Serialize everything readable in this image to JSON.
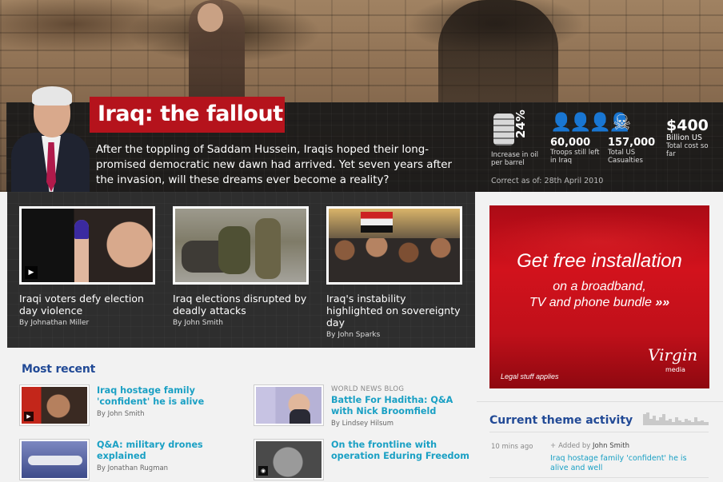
{
  "hero": {
    "title": "Iraq: the fallout",
    "dek": "After the toppling of Saddam Hussein, Iraqis hoped their long-promised democratic new dawn had arrived. Yet seven years after the invasion, will these dreams ever become a reality?",
    "stats": [
      {
        "value": "24%",
        "caption": "Increase in oil per barrel",
        "icon": "oil-barrel-icon"
      },
      {
        "value": "60,000",
        "caption": "Troops still left in Iraq",
        "icon": "troops-icon"
      },
      {
        "value": "157,000",
        "caption": "Total US Casualties",
        "icon": "skull-icon"
      },
      {
        "value": "$400",
        "unit": "Billion US",
        "caption": "Total cost so far"
      }
    ],
    "updated": "Correct as of: 28th April 2010"
  },
  "features": [
    {
      "headline": "Iraqi voters defy election day violence",
      "byline": "By Johnathan Miller",
      "video": true
    },
    {
      "headline": "Iraq elections disrupted by deadly attacks",
      "byline": "By John Smith",
      "video": false
    },
    {
      "headline": "Iraq's instability highlighted on sovereignty day",
      "byline": "By John Sparks",
      "video": false
    }
  ],
  "most_recent": {
    "title": "Most recent",
    "stories": [
      {
        "kicker": "",
        "headline": "Iraq hostage family 'confident' he is alive",
        "byline": "By John Smith"
      },
      {
        "kicker": "WORLD NEWS BLOG",
        "headline": "Battle For Haditha: Q&A with Nick Broomfield",
        "byline": "By Lindsey Hilsum"
      },
      {
        "kicker": "",
        "headline": "Q&A: military drones explained",
        "byline": "By Jonathan Rugman"
      },
      {
        "kicker": "",
        "headline": "On the frontline with operation Eduring Freedom",
        "byline": ""
      }
    ]
  },
  "ad": {
    "headline": "Get free installation",
    "sub_1": "on a broadband,",
    "sub_2": "TV and phone bundle",
    "arrows": "»»",
    "legal": "Legal stuff applies",
    "logo_script": "Virgin",
    "logo_word": "media"
  },
  "theme": {
    "title": "Current theme activity",
    "item": {
      "ago": "10 mins ago",
      "action": "Added by",
      "user": "John Smith",
      "link": "Iraq hostage family 'confident' he is alive and well"
    }
  },
  "colors": {
    "brand_red": "#b5131c",
    "section_blue": "#224a96",
    "link_cyan": "#1aa0c4"
  }
}
